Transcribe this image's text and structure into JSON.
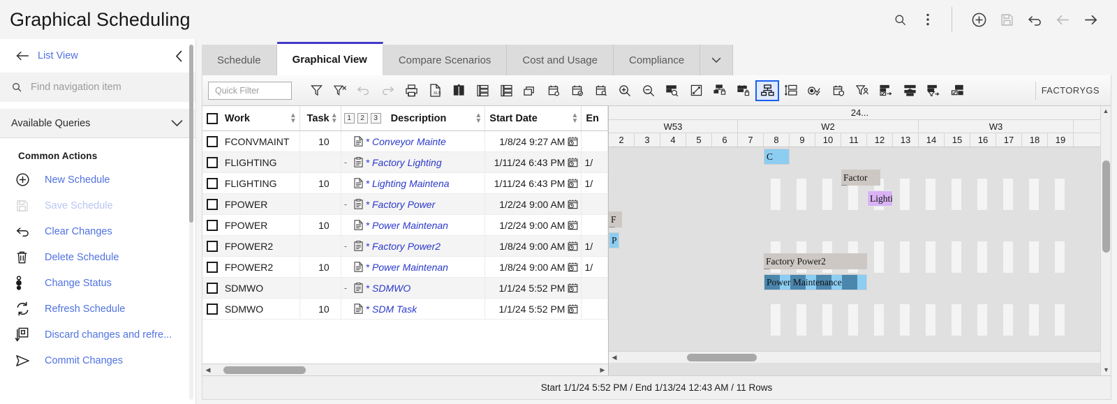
{
  "header": {
    "title": "Graphical Scheduling",
    "actions": [
      {
        "name": "search-icon",
        "label": "Search",
        "enabled": true
      },
      {
        "name": "overflow-menu-icon",
        "label": "More options",
        "enabled": true
      },
      {
        "name": "add-icon",
        "label": "New",
        "enabled": true
      },
      {
        "name": "save-icon",
        "label": "Save",
        "enabled": false
      },
      {
        "name": "undo-icon",
        "label": "Undo",
        "enabled": true
      },
      {
        "name": "back-arrow-icon",
        "label": "Back",
        "enabled": false
      },
      {
        "name": "forward-arrow-icon",
        "label": "Forward",
        "enabled": true
      }
    ]
  },
  "sidebar": {
    "back_label": "List View",
    "search_placeholder": "Find navigation item",
    "search_value": "",
    "queries_label": "Available Queries",
    "common_actions_label": "Common Actions",
    "actions": [
      {
        "label": "New Schedule",
        "icon": "plus-circle-icon",
        "enabled": true
      },
      {
        "label": "Save Schedule",
        "icon": "save-icon",
        "enabled": false
      },
      {
        "label": "Clear Changes",
        "icon": "undo-icon",
        "enabled": true
      },
      {
        "label": "Delete Schedule",
        "icon": "trash-icon",
        "enabled": true
      },
      {
        "label": "Change Status",
        "icon": "status-icon",
        "enabled": true
      },
      {
        "label": "Refresh Schedule",
        "icon": "refresh-icon",
        "enabled": true
      },
      {
        "label": "Discard changes and refre...",
        "icon": "discard-icon",
        "enabled": true
      },
      {
        "label": "Commit Changes",
        "icon": "send-icon",
        "enabled": true
      }
    ]
  },
  "tabs": {
    "items": [
      {
        "label": "Schedule",
        "active": false
      },
      {
        "label": "Graphical View",
        "active": true
      },
      {
        "label": "Compare Scenarios",
        "active": false
      },
      {
        "label": "Cost and Usage",
        "active": false
      },
      {
        "label": "Compliance",
        "active": false
      }
    ],
    "overflow_icon": "chevron-down-icon"
  },
  "toolbar": {
    "quick_filter_placeholder": "Quick Filter",
    "quick_filter_value": "",
    "scenario_label": "FACTORYGS",
    "buttons": [
      {
        "name": "filter-icon",
        "enabled": true,
        "selected": false
      },
      {
        "name": "clear-filter-icon",
        "enabled": true,
        "selected": false
      },
      {
        "name": "undo-icon",
        "enabled": false,
        "selected": false
      },
      {
        "name": "redo-icon",
        "enabled": false,
        "selected": false
      },
      {
        "name": "print-icon",
        "enabled": true,
        "selected": false
      },
      {
        "name": "export-xls-icon",
        "enabled": true,
        "selected": false
      },
      {
        "name": "gantt-compare-icon",
        "enabled": true,
        "selected": false
      },
      {
        "name": "list-stack-icon",
        "enabled": true,
        "selected": false
      },
      {
        "name": "resource-list-icon",
        "enabled": true,
        "selected": false
      },
      {
        "name": "layers-icon",
        "enabled": true,
        "selected": false
      },
      {
        "name": "calendar-add-icon",
        "enabled": true,
        "selected": false
      },
      {
        "name": "calendar-check-icon",
        "enabled": true,
        "selected": false
      },
      {
        "name": "calendar-search-icon",
        "enabled": true,
        "selected": false
      },
      {
        "name": "zoom-in-icon",
        "enabled": true,
        "selected": false
      },
      {
        "name": "zoom-out-icon",
        "enabled": true,
        "selected": false
      },
      {
        "name": "zoom-to-fit-icon",
        "enabled": true,
        "selected": false
      },
      {
        "name": "expand-icon",
        "enabled": true,
        "selected": false
      },
      {
        "name": "network-lock-icon",
        "enabled": true,
        "selected": false
      },
      {
        "name": "gantt-lock-icon",
        "enabled": true,
        "selected": false
      },
      {
        "name": "hierarchy-icon",
        "enabled": true,
        "selected": true
      },
      {
        "name": "split-layout-icon",
        "enabled": true,
        "selected": false
      },
      {
        "name": "progress-check-icon",
        "enabled": true,
        "selected": false
      },
      {
        "name": "calendar-shield-icon",
        "enabled": true,
        "selected": false
      },
      {
        "name": "filter-person-icon",
        "enabled": true,
        "selected": false
      },
      {
        "name": "assign-task-icon",
        "enabled": true,
        "selected": false
      },
      {
        "name": "level-resources-icon",
        "enabled": true,
        "selected": false
      },
      {
        "name": "filter-assign-icon",
        "enabled": true,
        "selected": false
      },
      {
        "name": "copy-task-icon",
        "enabled": true,
        "selected": false
      }
    ]
  },
  "grid": {
    "columns": [
      {
        "key": "check",
        "label": ""
      },
      {
        "key": "work",
        "label": "Work",
        "sortable": true
      },
      {
        "key": "task",
        "label": "Task",
        "sortable": true
      },
      {
        "key": "description",
        "label": "Description",
        "sortable": true
      },
      {
        "key": "start_date",
        "label": "Start Date",
        "sortable": true
      },
      {
        "key": "end_date",
        "label": "En"
      }
    ],
    "outline_levels": [
      "1",
      "2",
      "3"
    ],
    "rows": [
      {
        "work": "FCONVMAINT",
        "task": "10",
        "expander": "",
        "description": "* Conveyor Mainte",
        "start_date": "1/8/24 9:27 AM",
        "end_date": ""
      },
      {
        "work": "FLIGHTING",
        "task": "",
        "expander": "-",
        "description": "* Factory Lighting",
        "start_date": "1/11/24 6:43 PM",
        "end_date": "1/"
      },
      {
        "work": "FLIGHTING",
        "task": "10",
        "expander": "",
        "description": "* Lighting Maintena",
        "start_date": "1/11/24 6:43 PM",
        "end_date": "1/"
      },
      {
        "work": "FPOWER",
        "task": "",
        "expander": "-",
        "description": "* Factory Power",
        "start_date": "1/2/24 9:00 AM",
        "end_date": ""
      },
      {
        "work": "FPOWER",
        "task": "10",
        "expander": "",
        "description": "* Power Maintenan",
        "start_date": "1/2/24 9:00 AM",
        "end_date": ""
      },
      {
        "work": "FPOWER2",
        "task": "",
        "expander": "-",
        "description": "* Factory Power2",
        "start_date": "1/8/24 9:00 AM",
        "end_date": "1/"
      },
      {
        "work": "FPOWER2",
        "task": "10",
        "expander": "",
        "description": "* Power Maintenan",
        "start_date": "1/8/24 9:00 AM",
        "end_date": "1/"
      },
      {
        "work": "SDMWO",
        "task": "",
        "expander": "-",
        "description": "* SDMWO",
        "start_date": "1/1/24 5:52 PM",
        "end_date": ""
      },
      {
        "work": "SDMWO",
        "task": "10",
        "expander": "",
        "description": "* SDM Task",
        "start_date": "1/1/24 5:52 PM",
        "end_date": ""
      }
    ]
  },
  "gantt": {
    "year_label": "24...",
    "weeks": [
      {
        "label": "W53",
        "days": [
          "2",
          "3",
          "4",
          "5",
          "6"
        ]
      },
      {
        "label": "W2",
        "days": [
          "7",
          "8",
          "9",
          "10",
          "11",
          "12",
          "13"
        ]
      },
      {
        "label": "W3",
        "days": [
          "14",
          "15",
          "16",
          "17",
          "18",
          "19"
        ]
      }
    ],
    "bars": [
      {
        "label": "C",
        "type": "task",
        "row": 0,
        "start_day": "8",
        "span_days": 1,
        "color": "#8ccdf2"
      },
      {
        "label": "Factor",
        "type": "summary",
        "row": 1,
        "start_day": "11",
        "span_days": 1.5,
        "color": "#cdc8c4"
      },
      {
        "label": "Lightin",
        "type": "lavender",
        "row": 2,
        "start_day": "12",
        "span_days": 1,
        "color": "#d9b3f5"
      },
      {
        "label": "F",
        "type": "summary",
        "row": 3,
        "start_day": "2",
        "span_days": 0.5,
        "color": "#cdc8c4"
      },
      {
        "label": "P",
        "type": "task",
        "row": 4,
        "start_day": "2",
        "span_days": 0.4,
        "color": "#8ccdf2"
      },
      {
        "label": "Factory Power2",
        "type": "summary",
        "row": 5,
        "start_day": "8",
        "span_days": 4,
        "color": "#cdc8c4"
      },
      {
        "label": "Power Maintenance",
        "type": "striped",
        "row": 6,
        "start_day": "8",
        "span_days": 4,
        "color": "#4b86ad"
      }
    ]
  },
  "status": {
    "text": "Start 1/1/24 5:52 PM / End 1/13/24 12:43 AM / 11 Rows"
  }
}
